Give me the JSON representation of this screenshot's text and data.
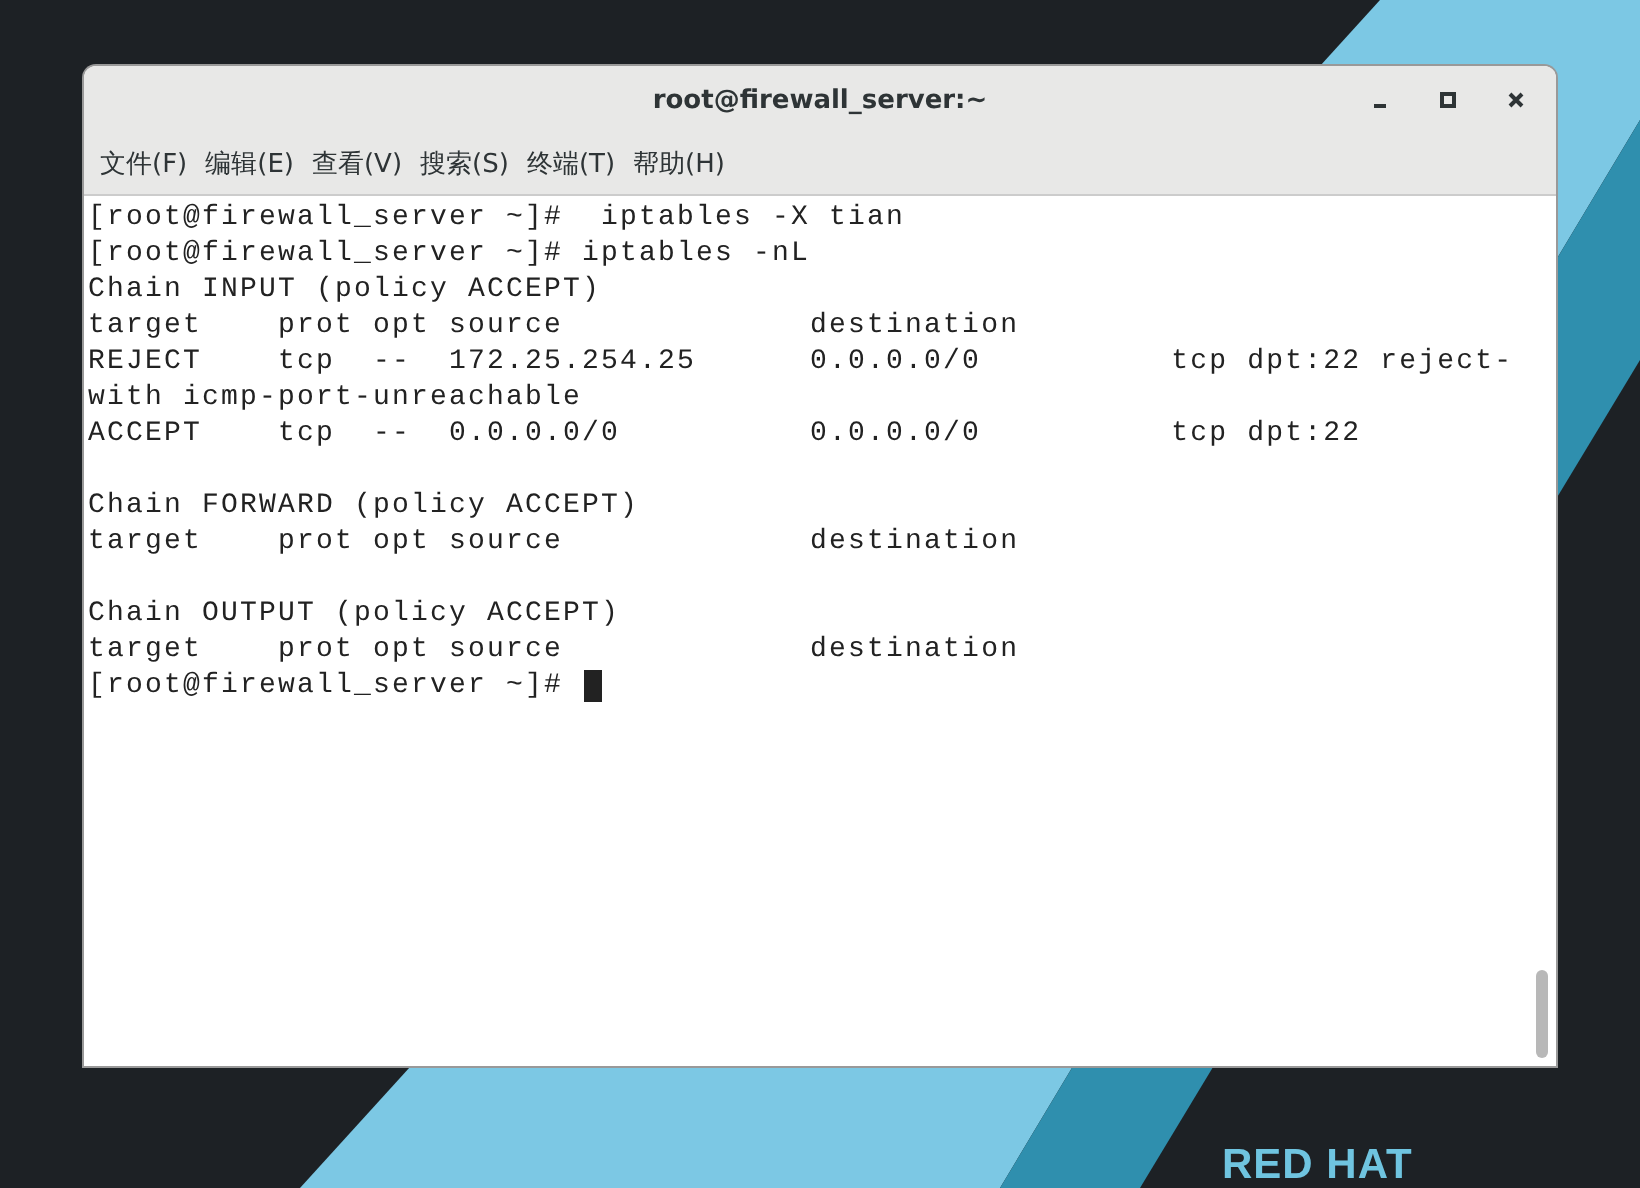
{
  "window": {
    "title": "root@firewall_server:~"
  },
  "menu": [
    "文件(F)",
    "编辑(E)",
    "查看(V)",
    "搜索(S)",
    "终端(T)",
    "帮助(H)"
  ],
  "terminal_blocks": [
    [
      "[root@firewall_server ~]#  iptables -X tian",
      "[root@firewall_server ~]# iptables -nL",
      "Chain INPUT (policy ACCEPT)",
      "target    prot opt source             destination",
      "REJECT    tcp  --  172.25.254.25      0.0.0.0/0          tcp dpt:22 reject-",
      "with icmp-port-unreachable",
      "ACCEPT    tcp  --  0.0.0.0/0          0.0.0.0/0          tcp dpt:22"
    ],
    [
      "Chain FORWARD (policy ACCEPT)",
      "target    prot opt source             destination"
    ],
    [
      "Chain OUTPUT (policy ACCEPT)",
      "target    prot opt source             destination"
    ]
  ],
  "prompt": "[root@firewall_server ~]#",
  "brand": "RED HAT"
}
